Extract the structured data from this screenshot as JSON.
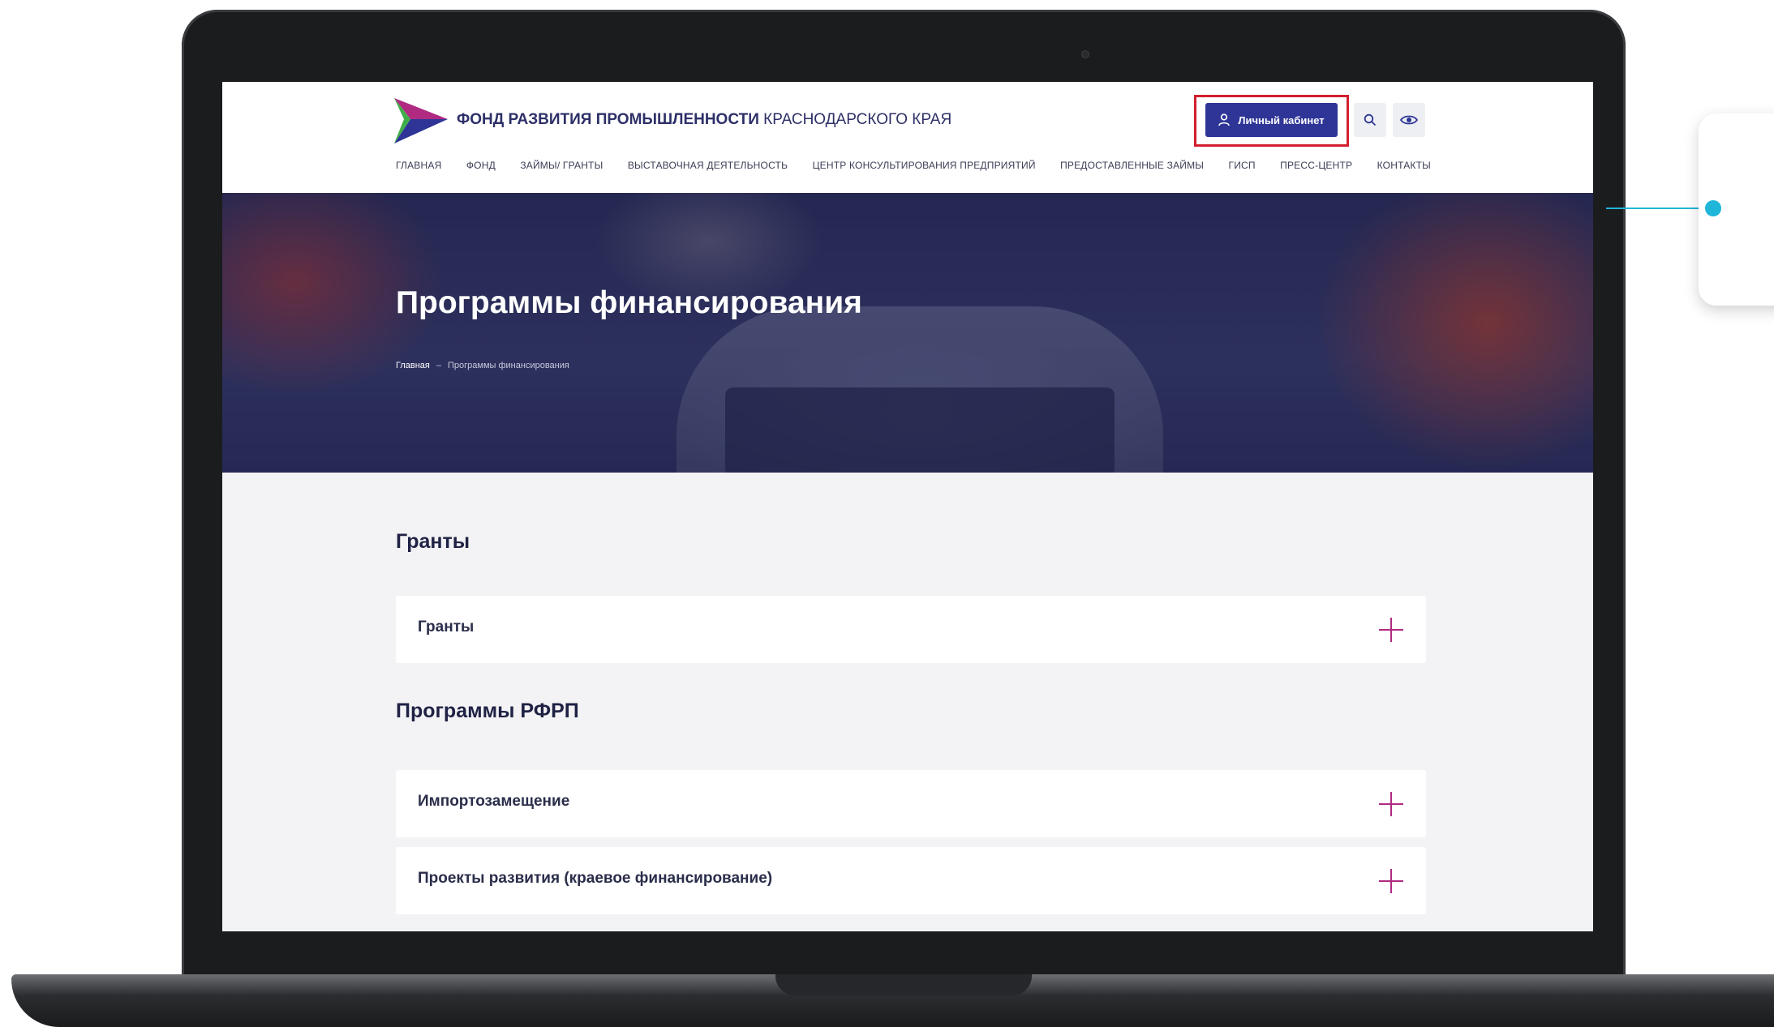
{
  "site": {
    "brand_bold": "ФОНД РАЗВИТИЯ ПРОМЫШЛЕННОСТИ",
    "brand_light": "КРАСНОДАРСКОГО КРАЯ",
    "cabinet_label": "Личный кабинет",
    "icons": [
      "logo-arrow",
      "user-icon",
      "search-icon",
      "eye-icon",
      "plus-icon"
    ],
    "colors": {
      "primary": "#2e3596",
      "accent": "#b02a82",
      "highlight": "#d11f2e",
      "callout_line": "#1fb6d9"
    }
  },
  "nav": [
    "ГЛАВНАЯ",
    "ФОНД",
    "ЗАЙМЫ/ ГРАНТЫ",
    "ВЫСТАВОЧНАЯ ДЕЯТЕЛЬНОСТЬ",
    "ЦЕНТР КОНСУЛЬТИРОВАНИЯ ПРЕДПРИЯТИЙ",
    "ПРЕДОСТАВЛЕННЫЕ ЗАЙМЫ",
    "ГИСП",
    "ПРЕСС-ЦЕНТР",
    "КОНТАКТЫ"
  ],
  "hero": {
    "title": "Программы финансирования",
    "breadcrumb_home": "Главная",
    "breadcrumb_sep": "–",
    "breadcrumb_current": "Программы финансирования"
  },
  "sections": [
    {
      "title": "Гранты",
      "items": [
        "Гранты"
      ]
    },
    {
      "title": "Программы РФРП",
      "items": [
        "Импортозамещение",
        "Проекты развития (краевое финансирование)"
      ]
    }
  ]
}
